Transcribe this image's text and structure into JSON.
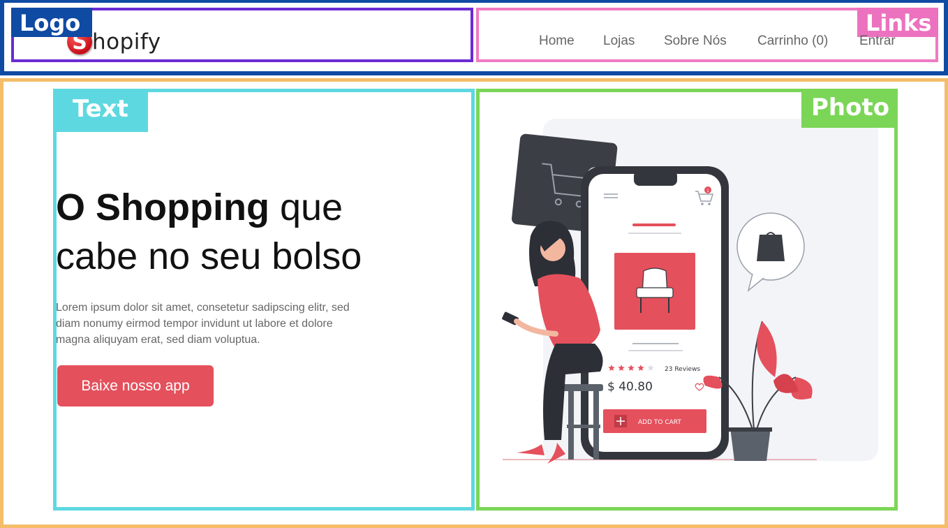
{
  "header": {
    "logo_tag": "Logo",
    "links_tag": "Links",
    "brand_initial": "S",
    "brand_rest": "hopify",
    "nav": [
      "Home",
      "Lojas",
      "Sobre Nós",
      "Carrinho (0)",
      "Entrar"
    ]
  },
  "main": {
    "text_tag": "Text",
    "photo_tag": "Photo",
    "headline_bold": "O Shopping",
    "headline_rest_1": " que",
    "headline_line2": "cabe no seu bolso",
    "body_lines": [
      "Lorem ipsum dolor sit amet, consetetur sadipscing elitr, sed",
      "diam nonumy eirmod tempor invidunt ut labore et dolore",
      "magna aliquyam erat, sed diam voluptua."
    ],
    "cta_label": "Baixe nosso app"
  },
  "phone": {
    "reviews": "23 Reviews",
    "price": "$ 40.80",
    "add_to_cart": "ADD TO CART",
    "cart_badge": "1",
    "rating": 4,
    "rating_max": 5
  },
  "colors": {
    "header_border": "#0f4aa3",
    "logo_box": "#6a2bd4",
    "links_box": "#f07ac2",
    "main_border": "#f5bd6a",
    "text_box": "#5ed8e0",
    "photo_box": "#7bd657",
    "accent": "#e4505c"
  }
}
